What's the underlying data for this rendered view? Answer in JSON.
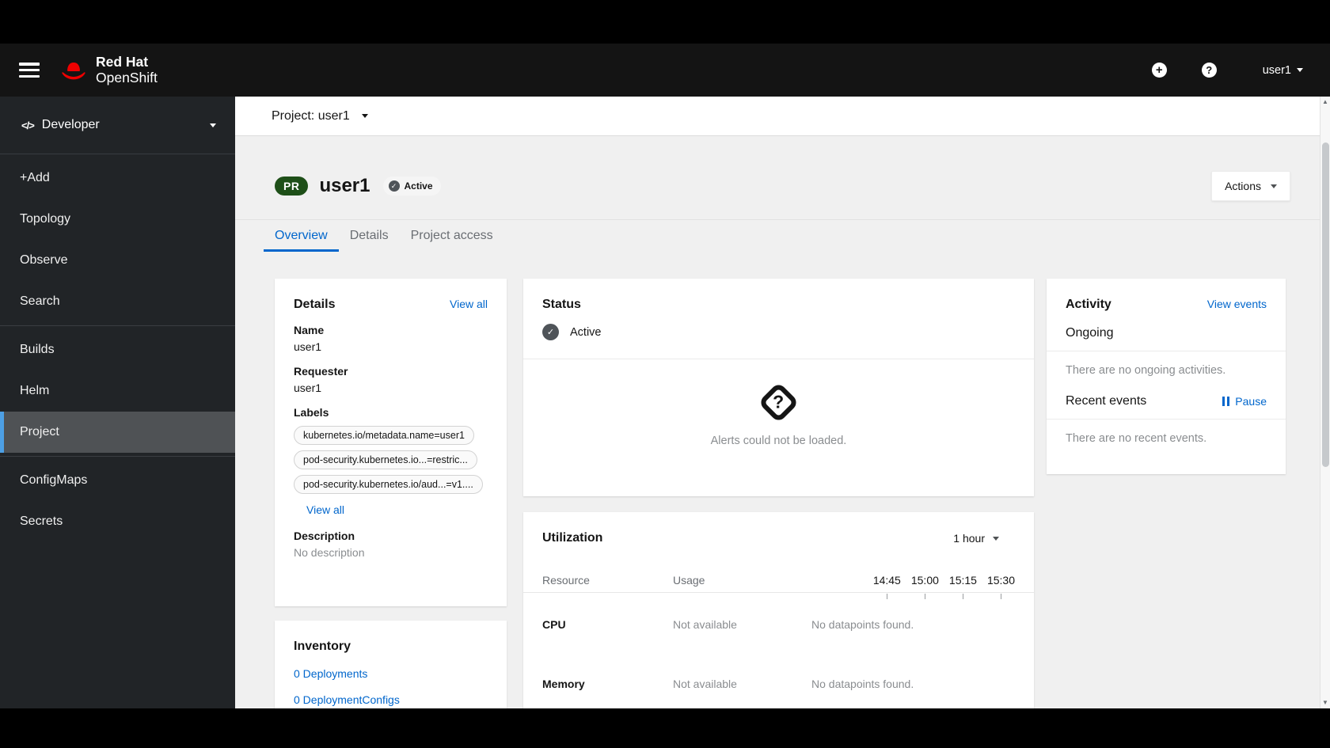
{
  "masthead": {
    "brand_top": "Red Hat",
    "brand_bottom": "OpenShift",
    "user_menu": "user1"
  },
  "sidebar": {
    "perspective": "Developer",
    "group1": [
      "+Add",
      "Topology",
      "Observe",
      "Search"
    ],
    "group2": [
      "Builds",
      "Helm",
      "Project"
    ],
    "group3": [
      "ConfigMaps",
      "Secrets"
    ],
    "active_item": "Project"
  },
  "toolbar": {
    "project_selector": "Project: user1"
  },
  "page_header": {
    "resource_badge": "PR",
    "title": "user1",
    "status": "Active",
    "actions_label": "Actions"
  },
  "tabs": [
    "Overview",
    "Details",
    "Project access"
  ],
  "details_card": {
    "title": "Details",
    "view_all_link": "View all",
    "name_label": "Name",
    "name_value": "user1",
    "requester_label": "Requester",
    "requester_value": "user1",
    "labels_label": "Labels",
    "label_chips": [
      "kubernetes.io/metadata.name=user1",
      "pod-security.kubernetes.io...=restric...",
      "pod-security.kubernetes.io/aud...=v1...."
    ],
    "labels_view_all_link": "View all",
    "description_label": "Description",
    "description_value": "No description"
  },
  "inventory_card": {
    "title": "Inventory",
    "items": [
      "0 Deployments",
      "0 DeploymentConfigs"
    ]
  },
  "status_card": {
    "title": "Status",
    "status": "Active",
    "alerts_empty": "Alerts could not be loaded."
  },
  "utilization_card": {
    "title": "Utilization",
    "duration": "1 hour",
    "col_resource": "Resource",
    "col_usage": "Usage",
    "times": [
      "14:45",
      "15:00",
      "15:15",
      "15:30"
    ],
    "rows": [
      {
        "resource": "CPU",
        "usage": "Not available",
        "datapoints": "No datapoints found."
      },
      {
        "resource": "Memory",
        "usage": "Not available",
        "datapoints": "No datapoints found."
      }
    ]
  },
  "activity_card": {
    "title": "Activity",
    "view_events_link": "View events",
    "ongoing_title": "Ongoing",
    "ongoing_empty": "There are no ongoing activities.",
    "recent_title": "Recent events",
    "pause_label": "Pause",
    "recent_empty": "There are no recent events."
  },
  "colors": {
    "accent_blue": "#0066cc",
    "nav_active_indicator": "#4d9fe4",
    "badge_green": "#1e4f18",
    "masthead_bg": "#141414",
    "sidebar_bg": "#212427",
    "status_icon_gray": "#4f5459",
    "page_bg": "#f0f0f0"
  }
}
